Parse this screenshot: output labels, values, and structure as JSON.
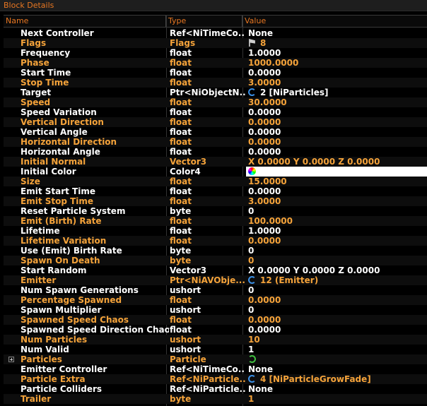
{
  "window": {
    "title": "Block Details"
  },
  "columns": {
    "name": "Name",
    "type": "Type",
    "value": "Value"
  },
  "rows": [
    {
      "name": "Next Controller",
      "type": "Ref<NiTimeCo...",
      "value": "None",
      "color": "white"
    },
    {
      "name": "Flags",
      "type": "Flags",
      "value": "8",
      "color": "orange",
      "icon": "flag-icon"
    },
    {
      "name": "Frequency",
      "type": "float",
      "value": "1.0000",
      "color": "white"
    },
    {
      "name": "Phase",
      "type": "float",
      "value": "1000.0000",
      "color": "orange"
    },
    {
      "name": "Start Time",
      "type": "float",
      "value": "0.0000",
      "color": "white"
    },
    {
      "name": "Stop Time",
      "type": "float",
      "value": "3.0000",
      "color": "orange"
    },
    {
      "name": "Target",
      "type": "Ptr<NiObjectN...",
      "value": "2 [NiParticles]",
      "color": "white",
      "icon": "link-icon"
    },
    {
      "name": "Speed",
      "type": "float",
      "value": "30.0000",
      "color": "orange"
    },
    {
      "name": "Speed Variation",
      "type": "float",
      "value": "0.0000",
      "color": "white"
    },
    {
      "name": "Vertical Direction",
      "type": "float",
      "value": "0.0000",
      "color": "orange"
    },
    {
      "name": "Vertical Angle",
      "type": "float",
      "value": "0.0000",
      "color": "white"
    },
    {
      "name": "Horizontal Direction",
      "type": "float",
      "value": "0.0000",
      "color": "orange"
    },
    {
      "name": "Horizontal Angle",
      "type": "float",
      "value": "0.0000",
      "color": "white"
    },
    {
      "name": "Initial Normal",
      "type": "Vector3",
      "value": "X 0.0000 Y 0.0000 Z 0.0000",
      "color": "orange"
    },
    {
      "name": "Initial Color",
      "type": "Color4",
      "value": "#ffffffff",
      "color": "white",
      "icon": "color-icon",
      "highlight": true
    },
    {
      "name": "Size",
      "type": "float",
      "value": "15.0000",
      "color": "orange"
    },
    {
      "name": "Emit Start Time",
      "type": "float",
      "value": "0.0000",
      "color": "white"
    },
    {
      "name": "Emit Stop Time",
      "type": "float",
      "value": "3.0000",
      "color": "orange"
    },
    {
      "name": "Reset Particle System",
      "type": "byte",
      "value": "0",
      "color": "white"
    },
    {
      "name": "Emit (Birth) Rate",
      "type": "float",
      "value": "100.0000",
      "color": "orange"
    },
    {
      "name": "Lifetime",
      "type": "float",
      "value": "1.0000",
      "color": "white"
    },
    {
      "name": "Lifetime Variation",
      "type": "float",
      "value": "0.0000",
      "color": "orange"
    },
    {
      "name": "Use (Emit) Birth Rate",
      "type": "byte",
      "value": "0",
      "color": "white"
    },
    {
      "name": "Spawn On Death",
      "type": "byte",
      "value": "0",
      "color": "orange"
    },
    {
      "name": "Start Random",
      "type": "Vector3",
      "value": "X 0.0000 Y 0.0000 Z 0.0000",
      "color": "white"
    },
    {
      "name": "Emitter",
      "type": "Ptr<NiAVObje...",
      "value": "12 (Emitter)",
      "color": "orange",
      "icon": "link-icon"
    },
    {
      "name": "Num Spawn Generations",
      "type": "ushort",
      "value": "0",
      "color": "white"
    },
    {
      "name": "Percentage Spawned",
      "type": "float",
      "value": "0.0000",
      "color": "orange"
    },
    {
      "name": "Spawn Multiplier",
      "type": "ushort",
      "value": "0",
      "color": "white"
    },
    {
      "name": "Spawned Speed Chaos",
      "type": "float",
      "value": "0.0000",
      "color": "orange"
    },
    {
      "name": "Spawned Speed Direction Chaos",
      "type": "float",
      "value": "0.0000",
      "color": "white"
    },
    {
      "name": "Num Particles",
      "type": "ushort",
      "value": "10",
      "color": "orange"
    },
    {
      "name": "Num Valid",
      "type": "ushort",
      "value": "1",
      "color": "white"
    },
    {
      "name": "Particles",
      "type": "Particle",
      "value": "",
      "color": "orange",
      "icon": "cycle-icon",
      "expandable": true
    },
    {
      "name": "Emitter Controller",
      "type": "Ref<NiTimeCo...",
      "value": "None",
      "color": "white"
    },
    {
      "name": "Particle Extra",
      "type": "Ref<NiParticle...",
      "value": "4 [NiParticleGrowFade]",
      "color": "orange",
      "icon": "link-icon"
    },
    {
      "name": "Particle Colliders",
      "type": "Ref<NiParticle...",
      "value": "None",
      "color": "white"
    },
    {
      "name": "Trailer",
      "type": "byte",
      "value": "1",
      "color": "orange"
    }
  ]
}
